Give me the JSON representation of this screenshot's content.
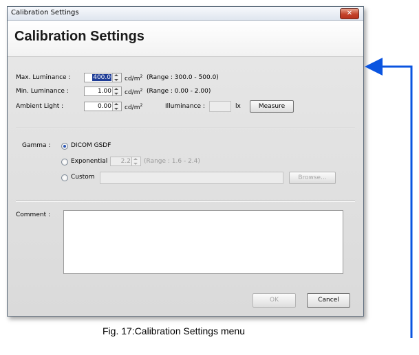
{
  "window": {
    "title": "Calibration Settings",
    "close_label": "✕"
  },
  "header": {
    "title": "Calibration Settings"
  },
  "luminance": {
    "max_label": "Max. Luminance :",
    "max_value": "400.0",
    "max_unit": "cd/m",
    "max_unit_sup": "2",
    "max_range": "(Range : 300.0 - 500.0)",
    "min_label": "Min. Luminance :",
    "min_value": "1.00",
    "min_unit": "cd/m",
    "min_unit_sup": "2",
    "min_range": "(Range : 0.00 - 2.00)",
    "ambient_label": "Ambient Light :",
    "ambient_value": "0.00",
    "ambient_unit": "cd/m",
    "ambient_unit_sup": "2",
    "illuminance_label": "Illuminance :",
    "illuminance_value": "",
    "illuminance_unit": "lx",
    "measure_button": "Measure"
  },
  "gamma": {
    "label": "Gamma :",
    "options": [
      {
        "label": "DICOM GSDF",
        "selected": true
      },
      {
        "label": "Exponential",
        "selected": false
      },
      {
        "label": "Custom",
        "selected": false
      }
    ],
    "exponential_value": "2.2",
    "exponential_range": "(Range : 1.6 - 2.4)",
    "custom_path": "",
    "browse_button": "Browse..."
  },
  "comment": {
    "label": "Comment :",
    "value": ""
  },
  "footer": {
    "ok_button": "OK",
    "cancel_button": "Cancel"
  },
  "caption": "Fig. 17:Calibration Settings menu",
  "colors": {
    "arrow": "#0a54e0",
    "title_bar_close": "#c4432a"
  }
}
